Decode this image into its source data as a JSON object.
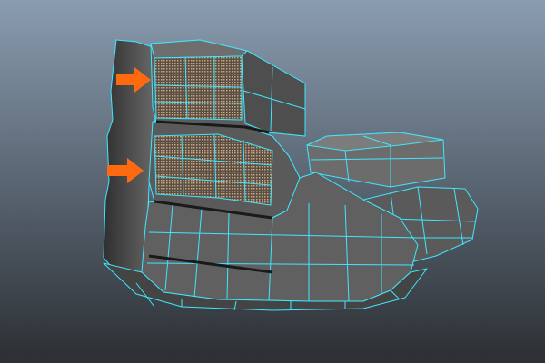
{
  "viewport": {
    "background_top": "#8a9cb0",
    "background_bottom": "#2c2f33"
  },
  "model": {
    "fill_color": "#5e5e5e",
    "fill_dark": "#3f3f3f",
    "fill_light": "#7a7a7a",
    "wireframe_color": "#3fe6ff",
    "selected_face_color": "#9a8468"
  },
  "annotations": {
    "arrow_color": "#ff6a10",
    "arrows": [
      {
        "name": "arrow-top-selection",
        "icon": "arrow-right-icon"
      },
      {
        "name": "arrow-mid-selection",
        "icon": "arrow-right-icon"
      }
    ]
  }
}
